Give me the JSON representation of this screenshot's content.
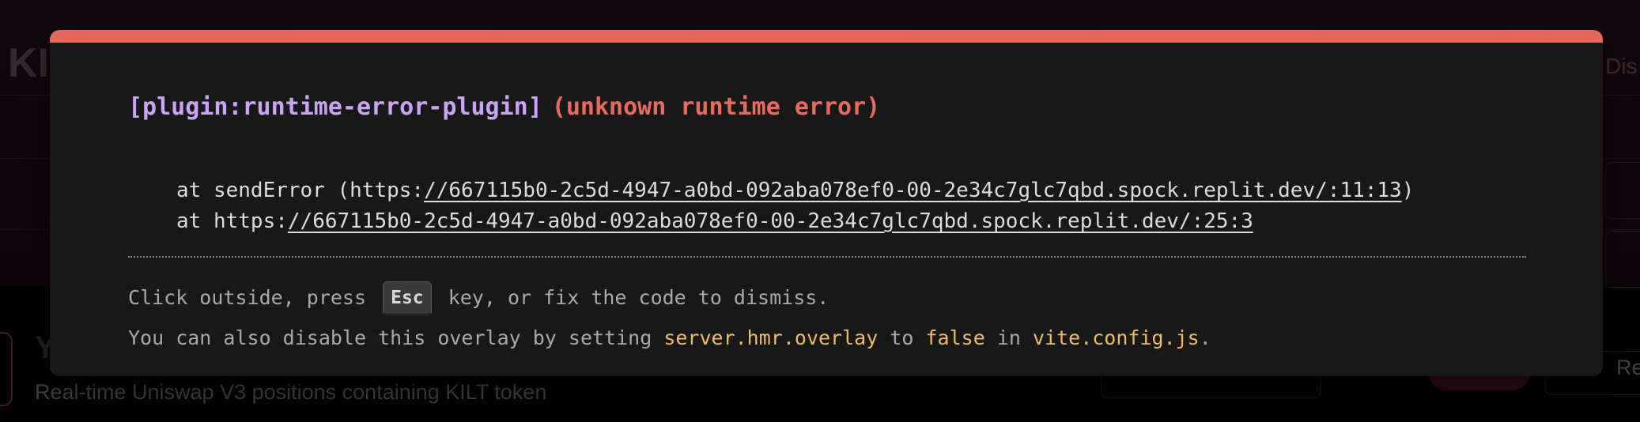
{
  "background_app": {
    "logo_text": "KI",
    "top_right_text": "Dis",
    "section_title": "Y",
    "section_subtitle": "Real-time Uniswap V3 positions containing KILT token",
    "button_label_partial": "Re"
  },
  "overlay": {
    "plugin_label": "[plugin:runtime-error-plugin]",
    "error_message": "(unknown runtime error)",
    "stack": [
      {
        "prefix": "at sendError (https:",
        "link": "//667115b0-2c5d-4947-a0bd-092aba078ef0-00-2e34c7glc7qbd.spock.replit.dev/:11:13",
        "suffix": ")"
      },
      {
        "prefix": "at https:",
        "link": "//667115b0-2c5d-4947-a0bd-092aba078ef0-00-2e34c7glc7qbd.spock.replit.dev/:25:3",
        "suffix": ""
      }
    ],
    "tip_line1": {
      "before": "Click outside, press",
      "key": "Esc",
      "after": "key, or fix the code to dismiss."
    },
    "tip_line2": {
      "t1": "You can also disable this overlay by setting",
      "c1": "server.hmr.overlay",
      "t2": "to",
      "c2": "false",
      "t3": "in",
      "c3": "vite.config.js",
      "t4": "."
    }
  },
  "colors": {
    "accent_bar": "#e8675c",
    "plugin_text": "#c9a4f7",
    "error_text": "#ea6a5e",
    "code_text": "#efbc5f"
  }
}
